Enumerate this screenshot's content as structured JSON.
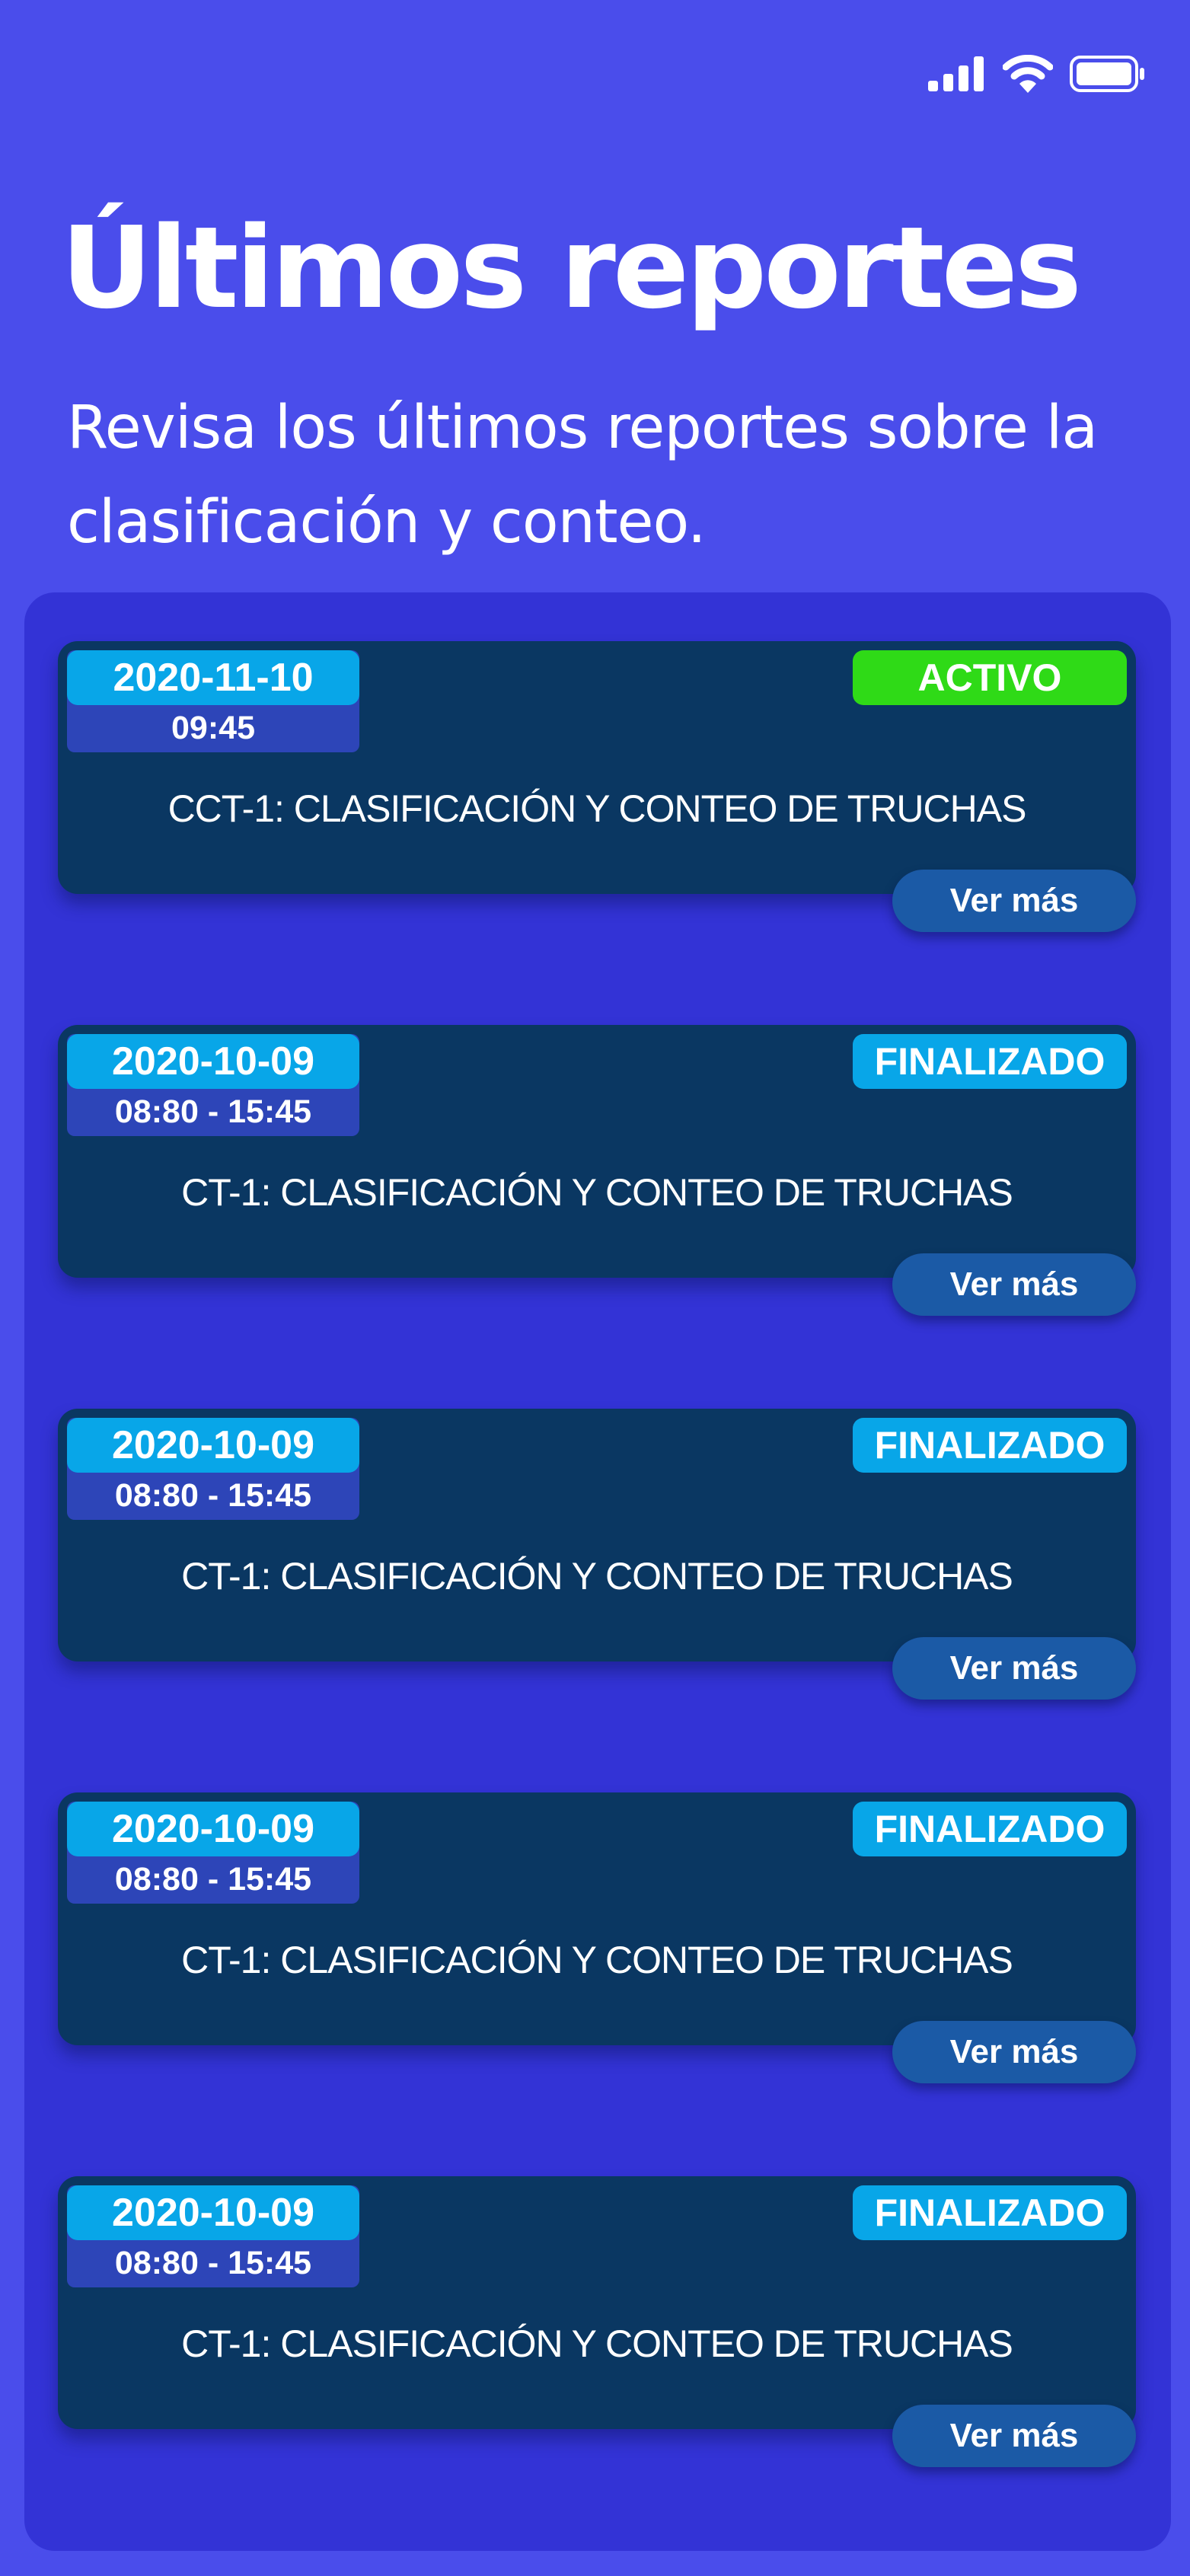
{
  "status_bar": {
    "signal_icon": "cellular-signal-icon",
    "wifi_icon": "wifi-icon",
    "battery_icon": "battery-icon"
  },
  "header": {
    "title": "Últimos reportes",
    "subtitle": "Revisa los últimos reportes sobre la clasificación y conteo."
  },
  "colors": {
    "background": "#4A4DEB",
    "panel": "#3333D6",
    "card": "#0A3762",
    "date_pill": "#08A6E8",
    "time_box": "#2D45B8",
    "active": "#2FDA17",
    "finished": "#08A6E8",
    "button": "#1B5AA6"
  },
  "reports": [
    {
      "date": "2020-11-10",
      "time": "09:45",
      "status": "ACTIVO",
      "status_color": "#2FDA17",
      "title": "CCT-1: CLASIFICACIÓN Y CONTEO DE TRUCHAS",
      "button": "Ver más"
    },
    {
      "date": "2020-10-09",
      "time": "08:80 - 15:45",
      "status": "FINALIZADO",
      "status_color": "#08A6E8",
      "title": "CT-1: CLASIFICACIÓN Y CONTEO DE TRUCHAS",
      "button": "Ver más"
    },
    {
      "date": "2020-10-09",
      "time": "08:80 - 15:45",
      "status": "FINALIZADO",
      "status_color": "#08A6E8",
      "title": "CT-1: CLASIFICACIÓN Y CONTEO DE TRUCHAS",
      "button": "Ver más"
    },
    {
      "date": "2020-10-09",
      "time": "08:80 - 15:45",
      "status": "FINALIZADO",
      "status_color": "#08A6E8",
      "title": "CT-1: CLASIFICACIÓN Y CONTEO DE TRUCHAS",
      "button": "Ver más"
    },
    {
      "date": "2020-10-09",
      "time": "08:80 - 15:45",
      "status": "FINALIZADO",
      "status_color": "#08A6E8",
      "title": "CT-1: CLASIFICACIÓN Y CONTEO DE TRUCHAS",
      "button": "Ver más"
    }
  ]
}
